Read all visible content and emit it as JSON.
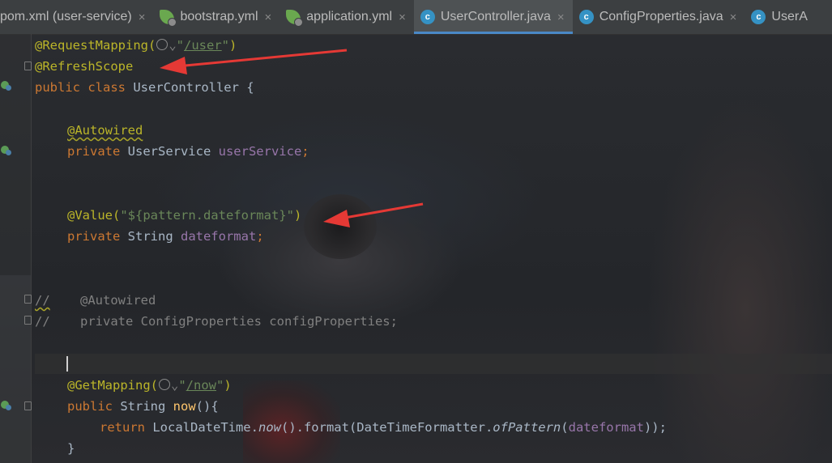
{
  "tabs": [
    {
      "label": "pom.xml (user-service)",
      "icon": "none",
      "active": false
    },
    {
      "label": "bootstrap.yml",
      "icon": "spring-yml-icon",
      "active": false
    },
    {
      "label": "application.yml",
      "icon": "spring-yml-icon",
      "active": false
    },
    {
      "label": "UserController.java",
      "icon": "class-icon",
      "active": true
    },
    {
      "label": "ConfigProperties.java",
      "icon": "class-icon",
      "active": false
    },
    {
      "label": "UserA",
      "icon": "class-icon",
      "active": false
    }
  ],
  "close_glyph": "×",
  "code": {
    "l1": {
      "ann": "@RequestMapping(",
      "chev": "⌄",
      "str_open": "\"",
      "path": "/user",
      "str_close": "\"",
      "close": ")"
    },
    "l2": {
      "ann": "@RefreshScope"
    },
    "l3": {
      "kw": "public class ",
      "name": "UserController {"
    },
    "l5": {
      "ann": "@Autowired"
    },
    "l6": {
      "kw": "private ",
      "type": "UserService ",
      "field": "userService",
      "semi": ";"
    },
    "l9": {
      "ann": "@Value(",
      "str": "\"${pattern.dateformat}\"",
      "close": ")"
    },
    "l10": {
      "kw": "private ",
      "type": "String ",
      "field": "dateformat",
      "semi": ";"
    },
    "l12": {
      "slashes": "//",
      "text": "    @Autowired"
    },
    "l13": {
      "slashes": "//",
      "text": "    private ConfigProperties configProperties;"
    },
    "l15": {
      "ann": "@GetMapping(",
      "chev": "⌄",
      "str_open": "\"",
      "path": "/now",
      "str_close": "\"",
      "close": ")"
    },
    "l16": {
      "kw": "public ",
      "type": "String ",
      "method": "now",
      "rest": "(){"
    },
    "l17": {
      "kw": "return ",
      "a": "LocalDateTime.",
      "now": "now",
      "b": "().format(DateTimeFormatter.",
      "of": "ofPattern",
      "c": "(",
      "field": "dateformat",
      "d": "));"
    },
    "l18": {
      "text": "}"
    }
  },
  "colors": {
    "annotation": "#bbb529",
    "keyword": "#cc7832",
    "string": "#6a8759",
    "field": "#9876aa",
    "arrow": "#e53935"
  }
}
